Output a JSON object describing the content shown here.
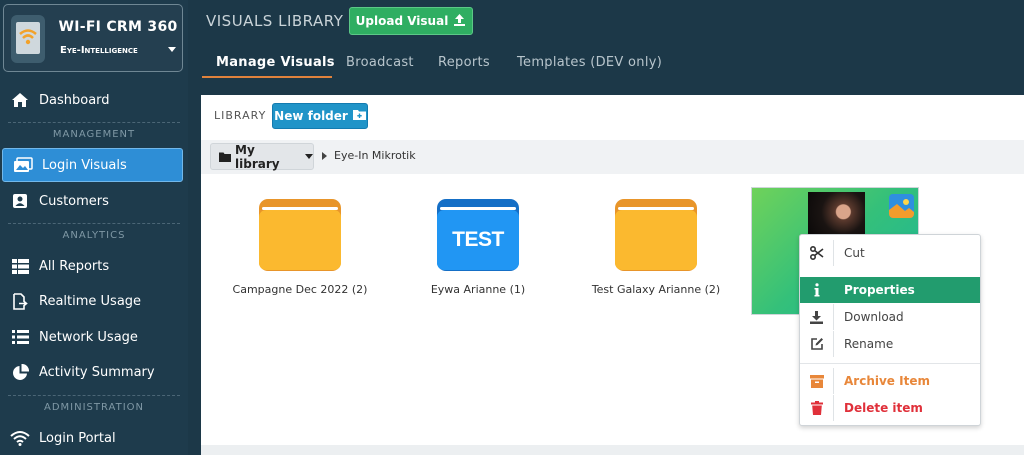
{
  "app": {
    "brand_title": "WI-FI CRM 360",
    "brand_subtitle": "Eye-Intelligence"
  },
  "sidebar": {
    "items": [
      {
        "label": "Dashboard",
        "icon": "home-icon"
      },
      {
        "section": "MANAGEMENT"
      },
      {
        "label": "Login Visuals",
        "icon": "image-gallery-icon",
        "active": true
      },
      {
        "label": "Customers",
        "icon": "contact-card-icon"
      },
      {
        "section": "ANALYTICS"
      },
      {
        "label": "All Reports",
        "icon": "grid-list-icon"
      },
      {
        "label": "Realtime Usage",
        "icon": "document-export-icon"
      },
      {
        "label": "Network Usage",
        "icon": "list-icon"
      },
      {
        "label": "Activity Summary",
        "icon": "pie-chart-icon"
      },
      {
        "section": "ADMINISTRATION"
      },
      {
        "label": "Login Portal",
        "icon": "wifi-icon"
      }
    ]
  },
  "header": {
    "title": "VISUALS LIBRARY",
    "upload_label": "Upload Visual",
    "tabs": [
      {
        "label": "Manage Visuals",
        "active": true
      },
      {
        "label": "Broadcast"
      },
      {
        "label": "Reports"
      },
      {
        "label": "Templates (DEV only)"
      }
    ]
  },
  "library": {
    "label": "LIBRARY",
    "new_folder_label": "New folder",
    "breadcrumb_root": "My library",
    "breadcrumb_current": "Eye-In Mikrotik",
    "items": [
      {
        "type": "folder",
        "caption": "Campagne Dec 2022 (2)",
        "color": "#f5a623"
      },
      {
        "type": "folder",
        "caption": "Eywa Arianne (1)",
        "color": "#1e88e5",
        "overlay_text": "TEST"
      },
      {
        "type": "folder",
        "caption": "Test Galaxy Arianne (2)",
        "color": "#f5a623"
      },
      {
        "type": "image",
        "selected": true
      }
    ]
  },
  "context_menu": {
    "items": [
      {
        "label": "Cut",
        "icon": "scissors-icon"
      },
      {
        "label": "Properties",
        "icon": "info-icon",
        "active": true
      },
      {
        "label": "Download",
        "icon": "download-icon"
      },
      {
        "label": "Rename",
        "icon": "edit-icon"
      },
      {
        "label": "Archive Item",
        "icon": "archive-icon",
        "color": "#e8873a"
      },
      {
        "label": "Delete item",
        "icon": "trash-icon",
        "color": "#e0303a"
      }
    ]
  },
  "colors": {
    "sidebar_bg": "#1e3b4c",
    "accent_blue": "#2e8ed6",
    "upload_green": "#2fae62",
    "tab_underline": "#e0823c",
    "menu_active": "#229c6e"
  }
}
